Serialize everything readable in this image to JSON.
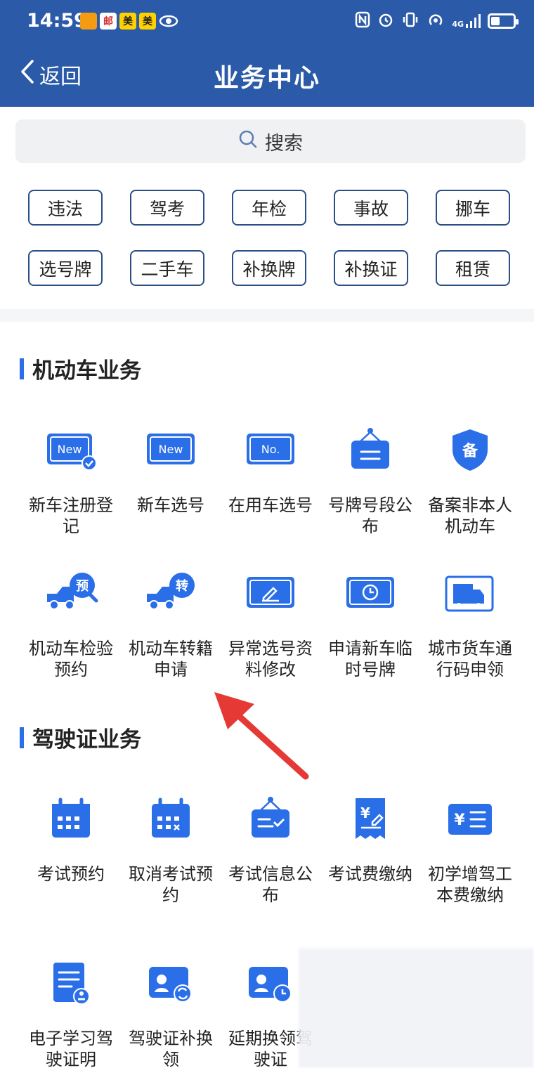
{
  "status_bar": {
    "time": "14:59",
    "network": "4G"
  },
  "header": {
    "back_label": "返回",
    "title": "业务中心"
  },
  "search": {
    "placeholder": "搜索"
  },
  "quick_chips": [
    "违法",
    "驾考",
    "年检",
    "事故",
    "挪车",
    "选号牌",
    "二手车",
    "补换牌",
    "补换证",
    "租赁"
  ],
  "sections": [
    {
      "title": "机动车业务",
      "items": [
        {
          "label": "新车注册登记",
          "icon": "new-plate-check-icon"
        },
        {
          "label": "新车选号",
          "icon": "new-plate-icon"
        },
        {
          "label": "在用车选号",
          "icon": "number-plate-icon"
        },
        {
          "label": "号牌号段公布",
          "icon": "hanging-sign-icon"
        },
        {
          "label": "备案非本人机动车",
          "icon": "shield-record-icon"
        },
        {
          "label": "机动车检验预约",
          "icon": "truck-reserve-icon"
        },
        {
          "label": "机动车转籍申请",
          "icon": "truck-transfer-icon"
        },
        {
          "label": "异常选号资料修改",
          "icon": "plate-edit-icon"
        },
        {
          "label": "申请新车临时号牌",
          "icon": "plate-clock-icon"
        },
        {
          "label": "城市货车通行码申领",
          "icon": "delivery-truck-icon"
        }
      ]
    },
    {
      "title": "驾驶证业务",
      "items": [
        {
          "label": "考试预约",
          "icon": "calendar-icon"
        },
        {
          "label": "取消考试预约",
          "icon": "calendar-cancel-icon"
        },
        {
          "label": "考试信息公布",
          "icon": "notice-board-icon"
        },
        {
          "label": "考试费缴纳",
          "icon": "receipt-yen-icon"
        },
        {
          "label": "初学增驾工本费缴纳",
          "icon": "yen-list-icon"
        },
        {
          "label": "电子学习驾驶证明",
          "icon": "document-stamp-icon"
        },
        {
          "label": "驾驶证补换领",
          "icon": "license-renew-icon"
        },
        {
          "label": "延期换领驾驶证",
          "icon": "license-clock-icon"
        }
      ]
    }
  ],
  "colors": {
    "header": "#2a5aa8",
    "icon_blue": "#2a6ee8",
    "chip_border": "#2a4f86",
    "annotation_arrow": "#e53935"
  }
}
